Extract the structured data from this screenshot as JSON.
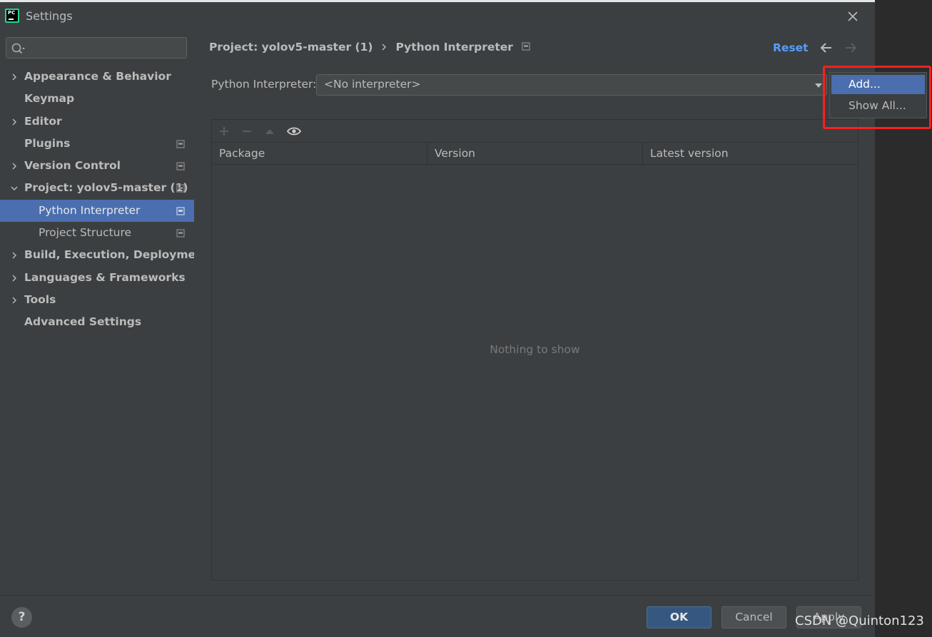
{
  "window": {
    "title": "Settings"
  },
  "sidebar": {
    "search_placeholder": "",
    "items": [
      {
        "label": "Appearance & Behavior",
        "expandable": true,
        "expanded": false
      },
      {
        "label": "Keymap",
        "expandable": false
      },
      {
        "label": "Editor",
        "expandable": true,
        "expanded": false
      },
      {
        "label": "Plugins",
        "expandable": false
      },
      {
        "label": "Version Control",
        "expandable": true,
        "expanded": false
      },
      {
        "label": "Project: yolov5-master (1)",
        "expandable": true,
        "expanded": true
      },
      {
        "label": "Python Interpreter",
        "child": true,
        "selected": true
      },
      {
        "label": "Project Structure",
        "child": true
      },
      {
        "label": "Build, Execution, Deployment",
        "expandable": true,
        "expanded": false
      },
      {
        "label": "Languages & Frameworks",
        "expandable": true,
        "expanded": false
      },
      {
        "label": "Tools",
        "expandable": true,
        "expanded": false
      },
      {
        "label": "Advanced Settings",
        "expandable": false
      }
    ]
  },
  "main": {
    "breadcrumb": {
      "parent": "Project: yolov5-master (1)",
      "current": "Python Interpreter"
    },
    "reset_label": "Reset",
    "interpreter": {
      "label": "Python Interpreter:",
      "value": "<No interpreter>"
    },
    "packages": {
      "columns": [
        "Package",
        "Version",
        "Latest version"
      ],
      "empty_text": "Nothing to show"
    }
  },
  "popup": {
    "items": [
      "Add...",
      "Show All..."
    ],
    "active_index": 0
  },
  "footer": {
    "ok_label": "OK",
    "cancel_label": "Cancel",
    "apply_label": "Apply",
    "help_label": "?"
  },
  "watermark": "CSDN @Quinton123",
  "colors": {
    "accent": "#4b6eaf",
    "link": "#589df6",
    "highlight": "#ff1f1f",
    "background": "#3c3f41"
  }
}
